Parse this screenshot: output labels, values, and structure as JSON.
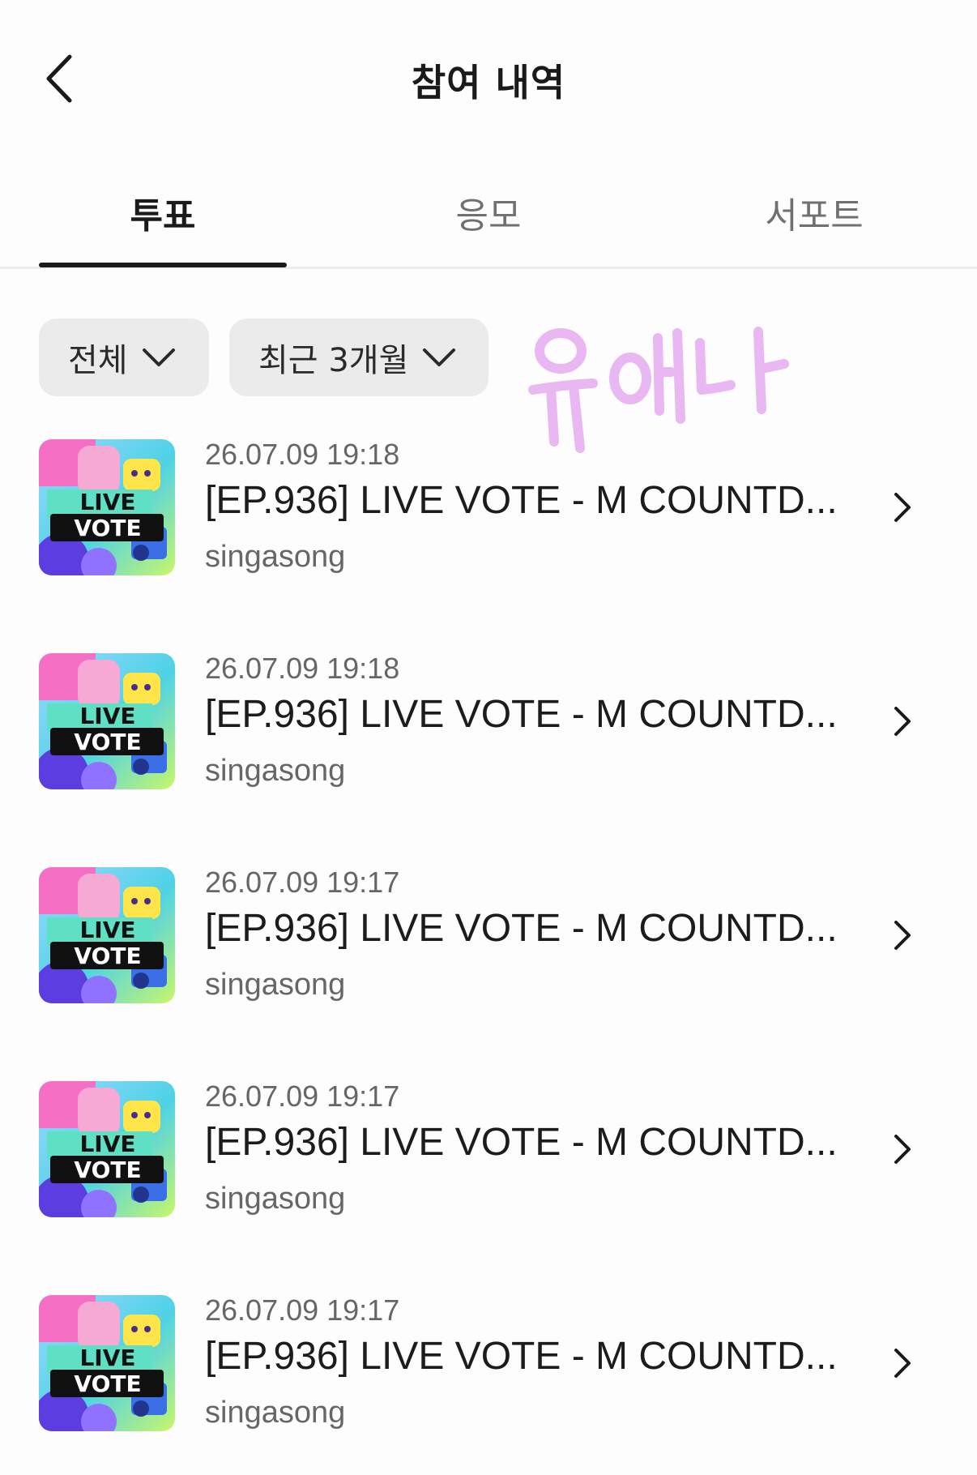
{
  "header": {
    "title": "참여 내역",
    "back_icon": "chevron-left-icon"
  },
  "tabs": [
    {
      "label": "투표",
      "active": true
    },
    {
      "label": "응모",
      "active": false
    },
    {
      "label": "서포트",
      "active": false
    }
  ],
  "filters": {
    "category": {
      "selected": "전체",
      "icon": "chevron-down-icon"
    },
    "period": {
      "selected": "최근 3개월",
      "icon": "chevron-down-icon"
    }
  },
  "watermark": {
    "text": "유애나",
    "color": "#e9b8f2"
  },
  "thumbnail": {
    "line1": "LIVE",
    "line2": "VOTE"
  },
  "items": [
    {
      "date": "26.07.09 19:18",
      "title": "[EP.936] LIVE VOTE - M COUNTD...",
      "author": "singasong"
    },
    {
      "date": "26.07.09 19:18",
      "title": "[EP.936] LIVE VOTE - M COUNTD...",
      "author": "singasong"
    },
    {
      "date": "26.07.09 19:17",
      "title": "[EP.936] LIVE VOTE - M COUNTD...",
      "author": "singasong"
    },
    {
      "date": "26.07.09 19:17",
      "title": "[EP.936] LIVE VOTE - M COUNTD...",
      "author": "singasong"
    },
    {
      "date": "26.07.09 19:17",
      "title": "[EP.936] LIVE VOTE - M COUNTD...",
      "author": "singasong"
    }
  ],
  "colors": {
    "accent": "#1a1a1a",
    "chip_bg": "#ebebec",
    "muted_text": "#666666"
  }
}
